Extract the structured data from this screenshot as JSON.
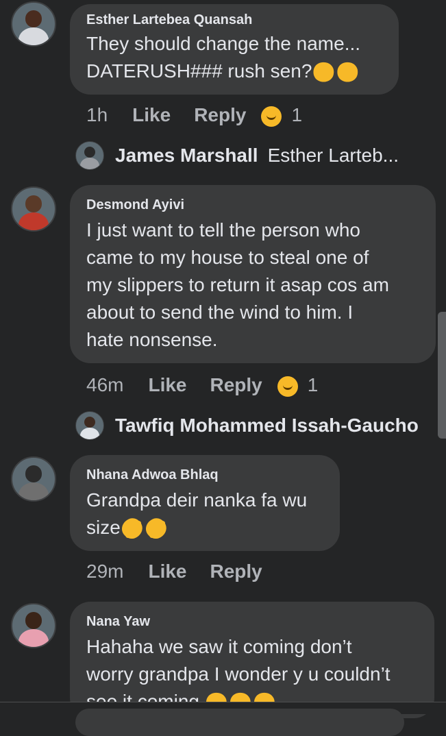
{
  "comments": [
    {
      "author": "Esther Lartebea Quansah",
      "text_lines": [
        "They should change the name...",
        "DATERUSH### rush sen?"
      ],
      "emojis": [
        "😆",
        "😀"
      ],
      "time": "1h",
      "like": "Like",
      "reply": "Reply",
      "reaction_icon": "laughing-emoji-icon",
      "reaction_count": "1",
      "reply_preview": {
        "name": "James Marshall",
        "text": "Esther Larteb..."
      }
    },
    {
      "author": "Desmond Ayivi",
      "text_lines": [
        "I just want to tell the person who",
        "came to my house to steal one of",
        "my slippers to return it asap cos am",
        "about to send the wind to him. I",
        "hate nonsense."
      ],
      "time": "46m",
      "like": "Like",
      "reply": "Reply",
      "reaction_icon": "laughing-emoji-icon",
      "reaction_count": "1",
      "reply_preview": {
        "name": "Tawfiq Mohammed Issah-Gaucho",
        "text": ""
      }
    },
    {
      "author": "Nhana Adwoa Bhlaq",
      "text_lines": [
        "Grandpa deir nanka fa wu",
        "size"
      ],
      "emojis": [
        "🤣",
        "🤣"
      ],
      "time": "29m",
      "like": "Like",
      "reply": "Reply"
    },
    {
      "author": "Nana Yaw",
      "text_lines": [
        "Hahaha we saw it coming don’t",
        "worry grandpa I wonder y u couldn’t",
        "see it coming"
      ],
      "emojis": [
        "😂",
        "😂",
        "😂"
      ]
    }
  ],
  "colors": {
    "background": "#242526",
    "bubble": "#3a3b3c",
    "text": "#e4e6eb",
    "meta": "#b0b3b8",
    "reaction": "#f7b928"
  }
}
